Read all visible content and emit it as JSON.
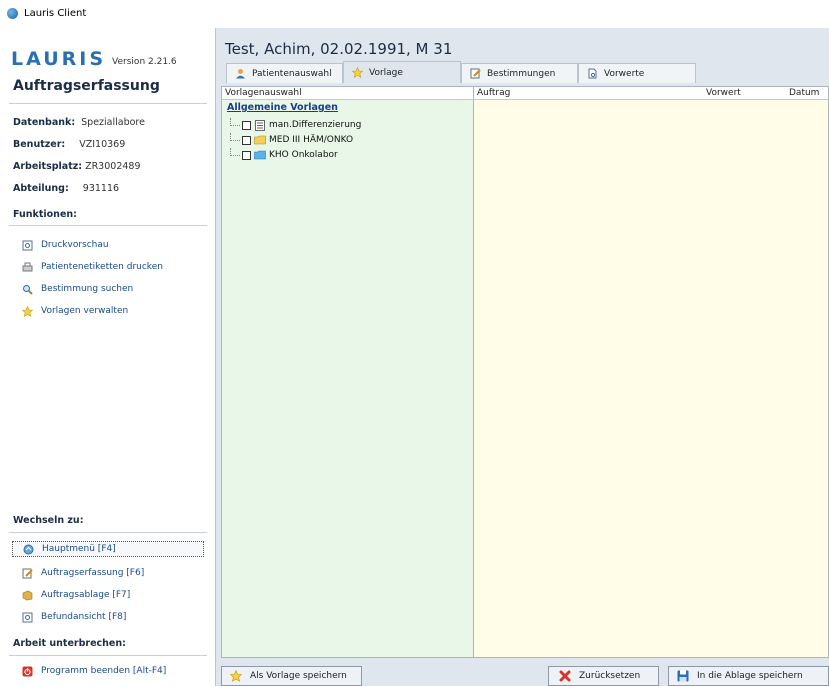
{
  "window": {
    "title": "Lauris Client"
  },
  "sidebar": {
    "logo": "LAURIS",
    "version": "Version 2.21.6",
    "module_title": "Auftragserfassung",
    "info": [
      {
        "label": "Datenbank:",
        "value": "Speziallabore"
      },
      {
        "label": "Benutzer:",
        "value": "VZI10369"
      },
      {
        "label": "Arbeitsplatz:",
        "value": "ZR3002489"
      },
      {
        "label": "Abteilung:",
        "value": "931116"
      }
    ],
    "functions_title": "Funktionen:",
    "functions": [
      {
        "label": "Druckvorschau",
        "icon": "print-preview-icon"
      },
      {
        "label": "Patientenetiketten drucken",
        "icon": "printer-icon"
      },
      {
        "label": "Bestimmung suchen",
        "icon": "magnifier-icon"
      },
      {
        "label": "Vorlagen verwalten",
        "icon": "star-icon"
      }
    ],
    "switch_title": "Wechseln zu:",
    "switch_items": [
      {
        "label": "Hauptmenü [F4]",
        "icon": "home-icon"
      },
      {
        "label": "Auftragserfassung [F6]",
        "icon": "edit-icon"
      },
      {
        "label": "Auftragsablage [F7]",
        "icon": "archive-icon"
      },
      {
        "label": "Befundansicht [F8]",
        "icon": "report-icon"
      }
    ],
    "interrupt_title": "Arbeit unterbrechen:",
    "interrupt_items": [
      {
        "label": "Programm beenden [Alt-F4]",
        "icon": "power-icon"
      }
    ]
  },
  "main": {
    "patient_title": "Test, Achim, 02.02.1991, M 31",
    "tabs": [
      {
        "label": "Patientenauswahl",
        "icon": "person-icon"
      },
      {
        "label": "Vorlage",
        "icon": "star-icon"
      },
      {
        "label": "Bestimmungen",
        "icon": "edit-icon"
      },
      {
        "label": "Vorwerte",
        "icon": "document-icon"
      }
    ],
    "left_panel": {
      "header": "Vorlagenauswahl",
      "root": "Allgemeine Vorlagen",
      "items": [
        {
          "label": "man.Differenzierung",
          "icon": "list-doc-icon"
        },
        {
          "label": "MED III HÄM/ONKO",
          "icon": "folder-icon"
        },
        {
          "label": "KHO Onkolabor",
          "icon": "folder-blue-icon"
        }
      ]
    },
    "right_panel": {
      "columns": [
        "Auftrag",
        "Vorwert",
        "Datum"
      ]
    },
    "buttons": {
      "save_template": "Als Vorlage speichern",
      "reset": "Zurücksetzen",
      "save_archive": "In die Ablage speichern"
    }
  },
  "colors": {
    "accent": "#2a6fb2",
    "left_panel_bg": "#e8f7e8",
    "right_panel_bg": "#fffde8",
    "main_bg": "#dfe6ee"
  }
}
